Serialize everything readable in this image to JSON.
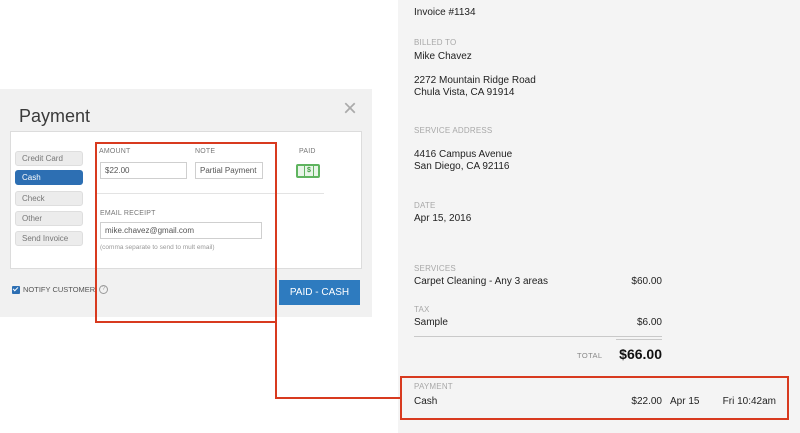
{
  "payment_modal": {
    "title": "Payment",
    "methods": [
      "Credit Card",
      "Cash",
      "Check",
      "Other",
      "Send Invoice"
    ],
    "active_method": "Cash",
    "amount_label": "AMOUNT",
    "amount_value": "$22.00",
    "note_label": "NOTE",
    "note_value": "Partial Payment",
    "paid_label": "PAID",
    "email_label": "EMAIL RECEIPT",
    "email_value": "mike.chavez@gmail.com",
    "email_hint": "(comma separate to send to mult email)",
    "notify_label": "NOTIFY CUSTOMER",
    "notify_checked": true,
    "paid_button": "PAID - CASH",
    "close_icon": "close-icon",
    "paid_icon": "money-icon",
    "accent_color": "#2e7bbf"
  },
  "invoice": {
    "title": "Invoice #1134",
    "billed_to_label": "BILLED TO",
    "customer_name": "Mike Chavez",
    "billing_address_line1": "2272 Mountain Ridge Road",
    "billing_address_line2": "Chula Vista, CA 91914",
    "service_address_label": "SERVICE ADDRESS",
    "service_address_line1": "4416 Campus Avenue",
    "service_address_line2": "San Diego, CA 92116",
    "date_label": "DATE",
    "date": "Apr 15, 2016",
    "services_label": "SERVICES",
    "service_item": "Carpet Cleaning - Any 3 areas",
    "service_amount": "$60.00",
    "tax_label": "TAX",
    "tax_item": "Sample",
    "tax_amount": "$6.00",
    "total_label": "TOTAL",
    "total_amount": "$66.00",
    "payment_label": "PAYMENT",
    "payment_method": "Cash",
    "payment_amount": "$22.00",
    "payment_date": "Apr 15",
    "payment_time": "Fri 10:42am"
  },
  "highlight_color": "#d83a1f"
}
